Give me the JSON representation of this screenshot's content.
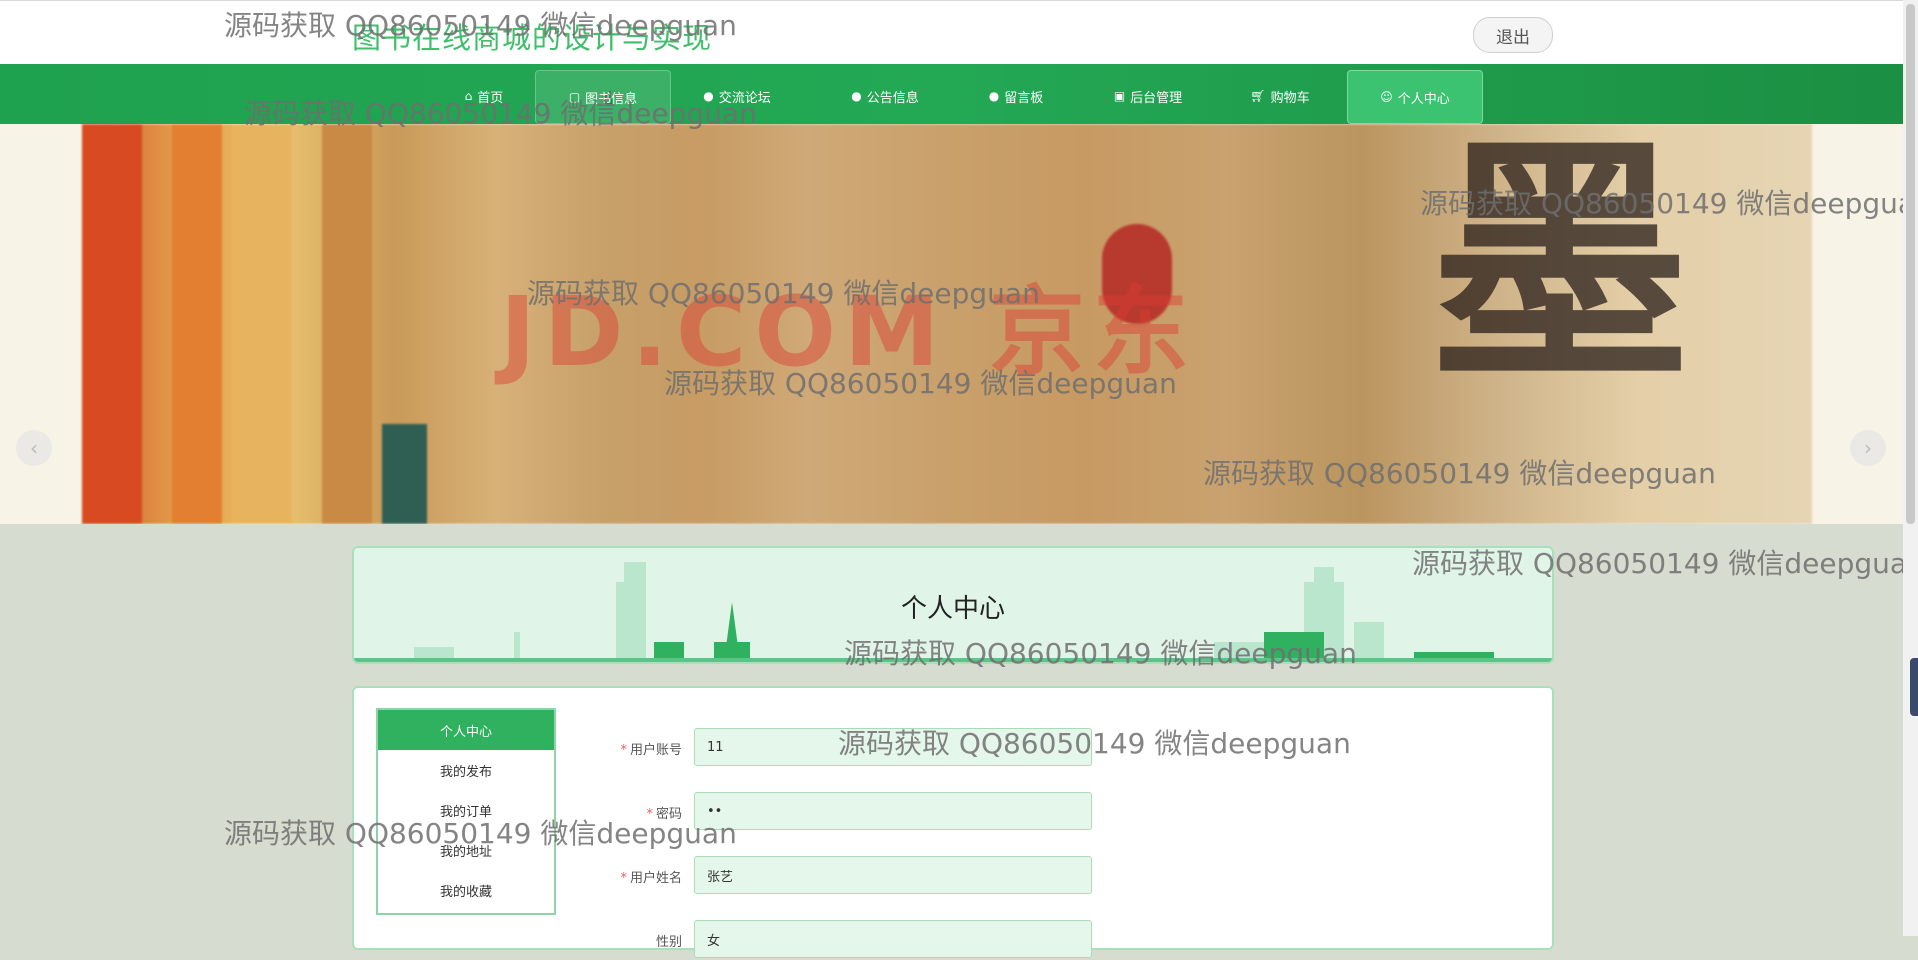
{
  "header": {
    "site_title": "图书在线商城的设计与实现",
    "logout_label": "退出"
  },
  "nav": {
    "items": [
      {
        "label": "首页",
        "icon": "home-icon"
      },
      {
        "label": "图书信息",
        "icon": "book-icon"
      },
      {
        "label": "交流论坛",
        "icon": "info-icon"
      },
      {
        "label": "公告信息",
        "icon": "help-icon"
      },
      {
        "label": "留言板",
        "icon": "info-icon"
      },
      {
        "label": "后台管理",
        "icon": "admin-icon"
      },
      {
        "label": "购物车",
        "icon": "cart-icon"
      },
      {
        "label": "个人中心",
        "icon": "user-icon"
      }
    ],
    "active": "个人中心"
  },
  "banner": {
    "caption": "JD.COM 京东",
    "big_char": "墨",
    "slide_count": 3,
    "active_slide": 3
  },
  "section": {
    "title": "个人中心"
  },
  "sidemenu": {
    "items": [
      "个人中心",
      "我的发布",
      "我的订单",
      "我的地址",
      "我的收藏"
    ]
  },
  "form": {
    "fields": [
      {
        "label": "用户账号",
        "value": "11",
        "required": true
      },
      {
        "label": "密码",
        "value": "••",
        "required": true
      },
      {
        "label": "用户姓名",
        "value": "张艺",
        "required": true
      },
      {
        "label": "性别",
        "value": "女",
        "required": false
      }
    ]
  },
  "watermark": "源码获取 QQ86050149 微信deepguan",
  "colors": {
    "nav_green": "#23a854",
    "title_green": "#3fbf6b",
    "active_green": "#2fb15f",
    "input_bg": "#e5f7ea"
  }
}
